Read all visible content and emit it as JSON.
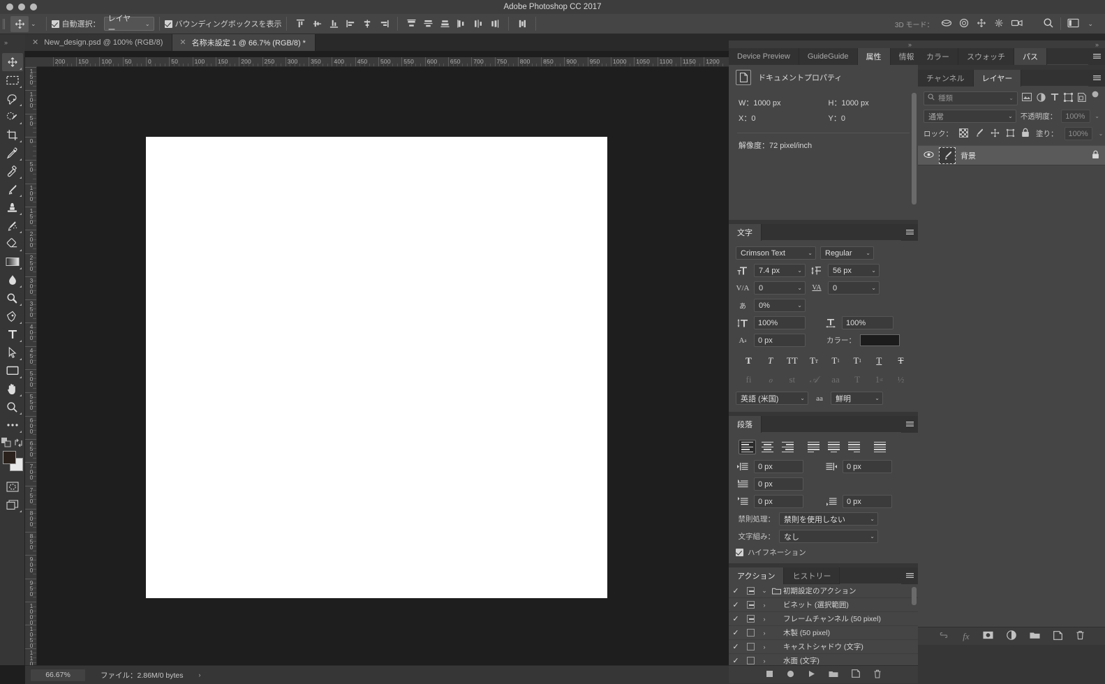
{
  "titlebar": {
    "title": "Adobe Photoshop CC 2017"
  },
  "options_bar": {
    "tool_icon": "move-tool-icon",
    "auto_select_label": "自動選択：",
    "auto_select_value": "レイヤー",
    "bounding_box_label": "バウンディングボックスを表示",
    "align_buttons": [
      "align-top-edges",
      "align-vertical-centers",
      "align-bottom-edges",
      "align-left-edges",
      "align-horizontal-centers",
      "align-right-edges"
    ],
    "distribute_buttons": [
      "distribute-top-edges",
      "distribute-vertical-centers",
      "distribute-bottom-edges",
      "distribute-left-edges",
      "distribute-horizontal-centers",
      "distribute-right-edges"
    ],
    "auto_align_button": "auto-align-layers",
    "mode_3d_label": "3D モード：",
    "mode_3d_buttons": [
      "orbit-3d",
      "roll-3d",
      "pan-3d",
      "slide-3d",
      "scale-3d"
    ],
    "search_icon": "search-icon",
    "workspace_icon": "workspace-switcher-icon"
  },
  "document_tabs": [
    {
      "label": "New_design.psd @ 100% (RGB/8)",
      "active": false
    },
    {
      "label": "名称未設定 1 @ 66.7% (RGB/8) *",
      "active": true
    }
  ],
  "toolbar": {
    "tools": [
      {
        "name": "move-tool",
        "active": true
      },
      {
        "name": "rectangular-marquee-tool",
        "active": false
      },
      {
        "name": "lasso-tool",
        "active": false
      },
      {
        "name": "quick-selection-tool",
        "active": false
      },
      {
        "name": "crop-tool",
        "active": false
      },
      {
        "name": "eyedropper-tool",
        "active": false
      },
      {
        "name": "spot-healing-brush-tool",
        "active": false
      },
      {
        "name": "brush-tool",
        "active": false
      },
      {
        "name": "clone-stamp-tool",
        "active": false
      },
      {
        "name": "history-brush-tool",
        "active": false
      },
      {
        "name": "eraser-tool",
        "active": false
      },
      {
        "name": "gradient-tool",
        "active": false
      },
      {
        "name": "blur-tool",
        "active": false
      },
      {
        "name": "dodge-tool",
        "active": false
      },
      {
        "name": "pen-tool",
        "active": false
      },
      {
        "name": "horizontal-type-tool",
        "active": false
      },
      {
        "name": "path-selection-tool",
        "active": false
      },
      {
        "name": "rectangle-tool",
        "active": false
      },
      {
        "name": "hand-tool",
        "active": false
      },
      {
        "name": "zoom-tool",
        "active": false
      },
      {
        "name": "edit-toolbar-tool",
        "active": false
      }
    ],
    "foreground_color": "#2b211c",
    "background_color": "#e8e8e8",
    "quick_mask_button": "quick-mask-mode",
    "screen_mode_button": "screen-mode"
  },
  "rulers": {
    "unit": "px",
    "horizontal_ticks": [
      200,
      150,
      100,
      50,
      0,
      50,
      100,
      150,
      200,
      250,
      300,
      350,
      400,
      450,
      500,
      550,
      600,
      650,
      700,
      750,
      800,
      850,
      900,
      950,
      1000,
      1050,
      1100,
      1150,
      1200
    ],
    "vertical_ticks": [
      150,
      100,
      50,
      0,
      50,
      100,
      150,
      200,
      250,
      300,
      350,
      400,
      450,
      500,
      550,
      600,
      650,
      700,
      750,
      800,
      850,
      900,
      950,
      1000,
      1050,
      1100
    ]
  },
  "canvas": {
    "background_color": "#1e1e1e",
    "artboard_color": "#ffffff"
  },
  "status_bar": {
    "zoom": "66.67%",
    "file_info": "ファイル：2.86M/0 bytes",
    "expand_arrow": "›"
  },
  "panels": {
    "properties_group": {
      "tabs": [
        {
          "label": "Device Preview",
          "active": false
        },
        {
          "label": "GuideGuide",
          "active": false
        },
        {
          "label": "属性",
          "active": true
        },
        {
          "label": "情報",
          "active": false
        }
      ],
      "doc_properties_title": "ドキュメントプロパティ",
      "doc_icon": "document-icon",
      "fields": [
        {
          "label": "W：",
          "value": "1000 px"
        },
        {
          "label": "H：",
          "value": "1000 px"
        },
        {
          "label": "X：",
          "value": "0"
        },
        {
          "label": "Y：",
          "value": "0"
        }
      ],
      "resolution": "解像度：72 pixel/inch"
    },
    "character_panel": {
      "tabs": [
        {
          "label": "文字",
          "active": true
        }
      ],
      "font_family": "Crimson Text",
      "font_style": "Regular",
      "font_size_icon": "font-size-icon",
      "font_size": "7.4 px",
      "leading_icon": "leading-icon",
      "leading": "56 px",
      "kerning_icon": "kerning-icon",
      "kerning": "0",
      "tracking_icon": "tracking-icon",
      "tracking": "0",
      "tsume_icon": "tsume-icon",
      "tsume": "0%",
      "vertical_scale_icon": "vertical-scale-icon",
      "vertical_scale": "100%",
      "horizontal_scale_icon": "horizontal-scale-icon",
      "horizontal_scale": "100%",
      "baseline_icon": "baseline-shift-icon",
      "baseline_shift": "0 px",
      "color_label": "カラー：",
      "color_value": "#1c1c1c",
      "style_buttons": [
        "T",
        "T",
        "TT",
        "Tт",
        "T¹",
        "T₁",
        "T",
        "T"
      ],
      "style_buttons_names": [
        "faux-bold",
        "faux-italic",
        "all-caps",
        "small-caps",
        "superscript",
        "subscript",
        "underline",
        "strikethrough"
      ],
      "opentype_buttons": [
        "fi",
        "ℴ",
        "st",
        "𝒜",
        "aa",
        "T",
        "1st",
        "½"
      ],
      "opentype_names": [
        "standard-ligatures",
        "discretionary-ligatures",
        "contextual-alternates",
        "swash",
        "titling-alternates",
        "ordinals",
        "fractions",
        "fractions-alt"
      ],
      "language": "英語 (米国)",
      "antialias_icon": "anti-alias-icon",
      "antialias": "鮮明"
    },
    "paragraph_panel": {
      "tabs": [
        {
          "label": "段落",
          "active": true
        }
      ],
      "align_buttons": [
        "align-left",
        "align-center",
        "align-right",
        "justify-last-left",
        "justify-last-center",
        "justify-last-right",
        "justify-all"
      ],
      "indent_left_icon": "indent-left-icon",
      "indent_left": "0 px",
      "indent_right_icon": "indent-right-icon",
      "indent_right": "0 px",
      "indent_first_icon": "indent-first-line-icon",
      "indent_first": "0 px",
      "space_before_icon": "space-before-icon",
      "space_before": "0 px",
      "space_after_icon": "space-after-icon",
      "space_after": "0 px",
      "kinsoku_label": "禁則処理：",
      "kinsoku_value": "禁則を使用しない",
      "mojikumi_label": "文字組み：",
      "mojikumi_value": "なし",
      "hyphenation_label": "ハイフネーション",
      "hyphenation_checked": true
    },
    "actions_panel": {
      "tabs": [
        {
          "label": "アクション",
          "active": true
        },
        {
          "label": "ヒストリー",
          "active": false
        }
      ],
      "rows": [
        {
          "check": "✓",
          "box": "filled",
          "arrow": "⌄",
          "icon": "folder-icon",
          "label": "初期設定のアクション"
        },
        {
          "check": "✓",
          "box": "filled",
          "arrow": "›",
          "icon": "",
          "label": "ビネット (選択範囲)"
        },
        {
          "check": "✓",
          "box": "filled",
          "arrow": "›",
          "icon": "",
          "label": "フレームチャンネル (50 pixel)"
        },
        {
          "check": "✓",
          "box": "empty",
          "arrow": "›",
          "icon": "",
          "label": "木製 (50 pixel)"
        },
        {
          "check": "✓",
          "box": "empty",
          "arrow": "›",
          "icon": "",
          "label": "キャストシャドウ (文字)"
        },
        {
          "check": "✓",
          "box": "empty",
          "arrow": "›",
          "icon": "",
          "label": "水面 (文字)"
        }
      ],
      "bottom_buttons": [
        "stop-button",
        "record-button",
        "play-button",
        "new-set-button",
        "new-action-button",
        "delete-button"
      ]
    },
    "color_group": {
      "tabs": [
        {
          "label": "カラー",
          "active": false
        },
        {
          "label": "スウォッチ",
          "active": false
        },
        {
          "label": "パス",
          "active": true
        }
      ]
    },
    "layers_panel": {
      "tabs": [
        {
          "label": "チャンネル",
          "active": false
        },
        {
          "label": "レイヤー",
          "active": true
        }
      ],
      "filter_placeholder": "種類",
      "filter_icons": [
        "pixel-filter-icon",
        "adjustment-filter-icon",
        "type-filter-icon",
        "shape-filter-icon",
        "smart-object-filter-icon"
      ],
      "filter_toggle": "filter-toggle",
      "blend_mode": "通常",
      "opacity_label": "不透明度：",
      "opacity_value": "100%",
      "lock_label": "ロック：",
      "lock_icons": [
        "lock-transparent-icon",
        "lock-image-icon",
        "lock-position-icon",
        "lock-artboard-icon",
        "lock-all-icon"
      ],
      "fill_label": "塗り：",
      "fill_value": "100%",
      "layers": [
        {
          "name": "背景",
          "visible": true,
          "locked": true,
          "thumb": "brush-thumbnail",
          "selected": true
        }
      ],
      "bottom_buttons": [
        "link-layers-icon",
        "layer-style-icon",
        "layer-mask-icon",
        "adjustment-layer-icon",
        "new-group-icon",
        "new-layer-icon",
        "delete-layer-icon"
      ]
    }
  }
}
